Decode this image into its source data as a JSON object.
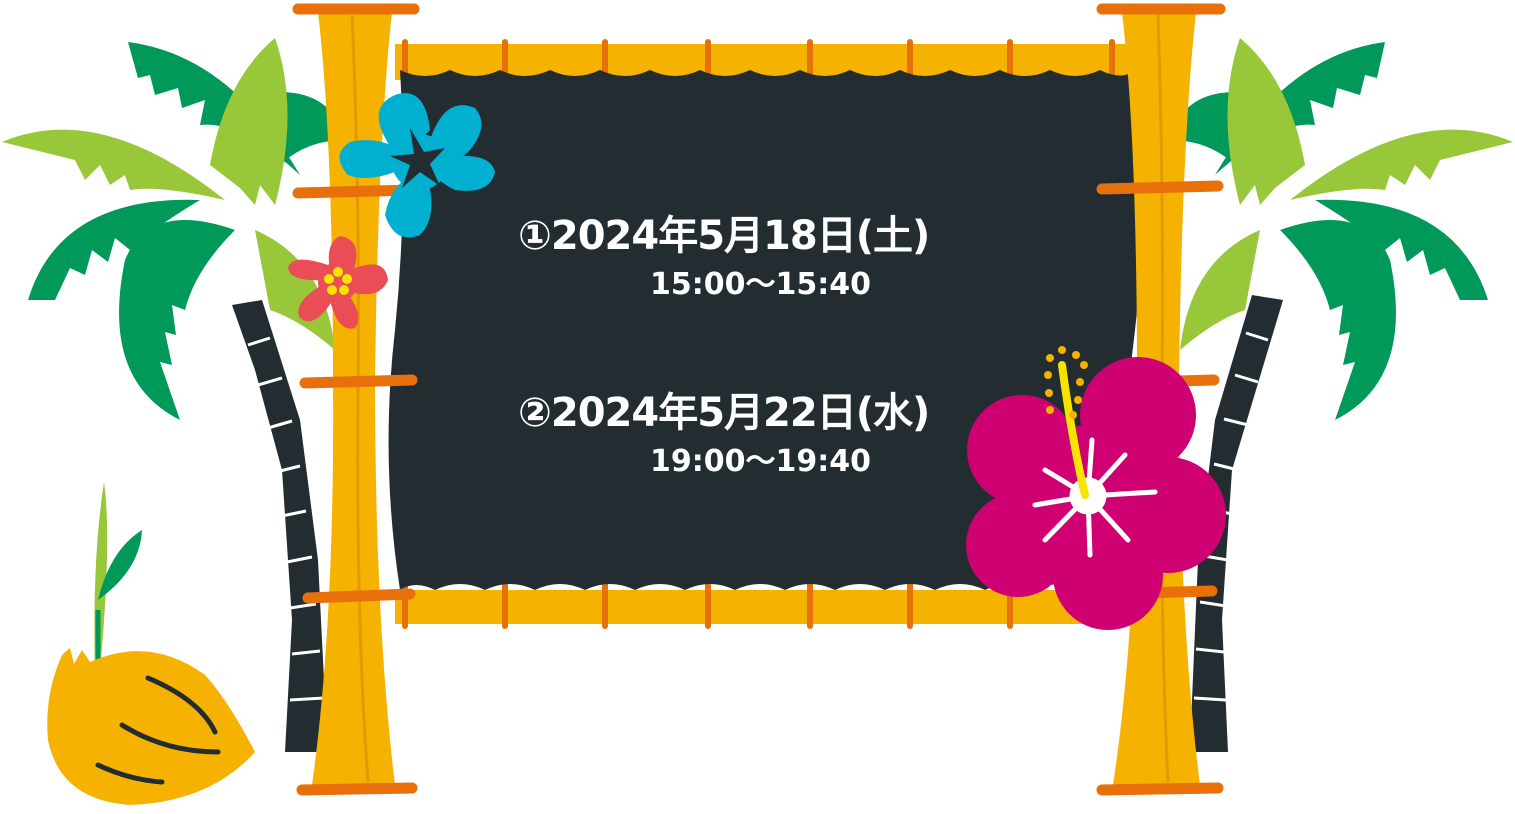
{
  "schedule": {
    "session_1": {
      "date": "①2024年5月18日(土)",
      "time": "15:00〜15:40"
    },
    "session_2": {
      "date": "②2024年5月22日(水)",
      "time": "19:00〜19:40"
    }
  },
  "colors": {
    "board": "#232c31",
    "bamboo": "#f5b200",
    "bamboo_band": "#e8700a",
    "palm_dark": "#00995a",
    "palm_light": "#99c73a",
    "trunk": "#232c31",
    "flower_blue": "#00b0d1",
    "flower_red": "#ea4d55",
    "hibiscus": "#cf0072",
    "coconut": "#f5b200"
  },
  "icons": {
    "left_palm": "palm-tree-icon",
    "right_palm": "palm-tree-icon",
    "blue_flower": "plumeria-flower-icon",
    "red_flower": "small-flower-icon",
    "hibiscus": "hibiscus-flower-icon",
    "coconut": "sprouting-coconut-icon"
  }
}
